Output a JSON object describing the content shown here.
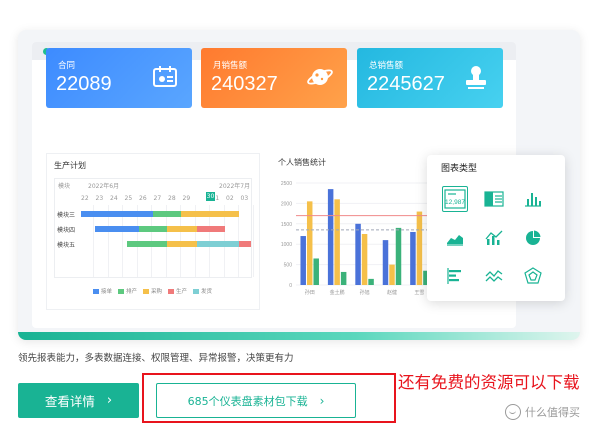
{
  "kpis": [
    {
      "label": "合同",
      "value": "22089",
      "icon": "calendar-card-icon"
    },
    {
      "label": "月销售额",
      "value": "240327",
      "icon": "planet-icon"
    },
    {
      "label": "总销售额",
      "value": "2245627",
      "icon": "stamp-icon"
    }
  ],
  "gantt": {
    "title": "生产计划",
    "corner_label": "模块",
    "month1": "2022年6月",
    "month2": "2022年7月",
    "days": [
      "22",
      "23",
      "24",
      "25",
      "26",
      "27",
      "28",
      "29",
      "30",
      "01",
      "02",
      "03"
    ],
    "today": "30",
    "rows": [
      "模块三",
      "模块四",
      "模块五"
    ],
    "legend": [
      "接单",
      "排产",
      "采购",
      "生产",
      "发货"
    ],
    "colors": {
      "接单": "#4a8ef0",
      "排产": "#5dc97f",
      "采购": "#f5c04a",
      "生产": "#f07a7a",
      "发货": "#7ecfd4"
    }
  },
  "sales": {
    "title": "个人销售统计",
    "y_ticks": [
      "2500",
      "2000",
      "1500",
      "1000",
      "500",
      "0"
    ],
    "categories": [
      "孙田",
      "金土鹏",
      "孙旭",
      "赵健",
      "王雪",
      "刘鸣",
      "王五"
    ]
  },
  "chart_data": {
    "type": "bar",
    "title": "个人销售统计",
    "categories": [
      "孙田",
      "金土鹏",
      "孙旭",
      "赵健",
      "王雪",
      "刘鸣",
      "王五"
    ],
    "ylim": [
      0,
      2500
    ],
    "series": [
      {
        "values": [
          1200,
          2350,
          1500,
          1100,
          1300,
          1350,
          1250
        ],
        "color": "#4a72d9"
      },
      {
        "values": [
          2050,
          2100,
          1250,
          500,
          1800,
          1850,
          2000
        ],
        "color": "#f5c04a"
      },
      {
        "values": [
          650,
          320,
          150,
          1400,
          350,
          950,
          550
        ],
        "color": "#3bb27a"
      }
    ],
    "reference_lines": [
      {
        "value": 1700,
        "color": "#f08a8a"
      },
      {
        "value": 1350,
        "color": "#a0a8b8"
      }
    ]
  },
  "popup": {
    "title": "图表类型",
    "icons": [
      "number-card-icon",
      "table-list-icon",
      "bar-chart-icon",
      "area-chart-icon",
      "line-bar-chart-icon",
      "pie-chart-icon",
      "horizontal-bar-icon",
      "line-chart-icon",
      "radar-chart-icon"
    ],
    "number_card_text": "12,987"
  },
  "tagline": "领先报表能力，多表数据连接、权限管理、异常报警，决策更有力",
  "buttons": {
    "detail": "查看详情",
    "detail_arrow": "›",
    "download": "685个仪表盘素材包下载",
    "download_arrow": "›"
  },
  "annotation": "还有免费的资源可以下载",
  "watermark": "什么值得买"
}
